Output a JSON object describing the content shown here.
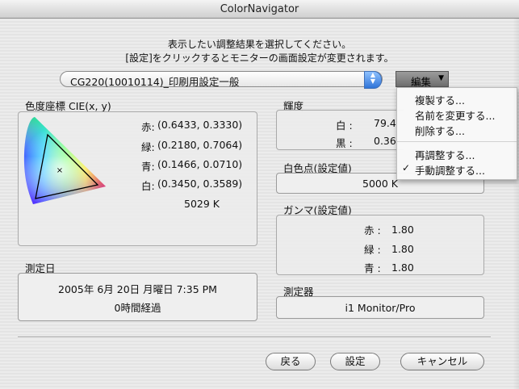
{
  "window": {
    "title": "ColorNavigator"
  },
  "instructions": {
    "line1": "表示したい調整結果を選択してください。",
    "line2": "[設定]をクリックするとモニターの画面設定が変更されます。"
  },
  "profile_select": {
    "value": "CG220(10010114)_印刷用設定一般"
  },
  "edit_menu": {
    "label": "編集",
    "items": [
      "複製する...",
      "名前を変更する...",
      "削除する...",
      "再調整する...",
      "手動調整する..."
    ],
    "checked_item": "手動調整する..."
  },
  "chromaticity": {
    "title": "色度座標 CIE(x, y)",
    "red_label": "赤:",
    "red_value": "(0.6433, 0.3330)",
    "green_label": "緑:",
    "green_value": "(0.2180, 0.7064)",
    "blue_label": "青:",
    "blue_value": "(0.1466, 0.0710)",
    "white_label": "白:",
    "white_value": "(0.3450, 0.3589)",
    "temperature": "5029 K"
  },
  "luminance": {
    "title": "輝度",
    "white_label": "白 :",
    "white_value": "79.4",
    "black_label": "黒 :",
    "black_value": "0.36"
  },
  "whitepoint": {
    "title": "白色点(設定値)",
    "value": "5000 K"
  },
  "gamma": {
    "title": "ガンマ(設定値)",
    "red_label": "赤 :",
    "red_value": "1.80",
    "green_label": "緑 :",
    "green_value": "1.80",
    "blue_label": "青 :",
    "blue_value": "1.80"
  },
  "measured_date": {
    "title": "測定日",
    "date": "2005年 6月 20日 月曜日 7:35 PM",
    "elapsed": "0時間経過"
  },
  "instrument": {
    "title": "測定器",
    "value": "i1 Monitor/Pro"
  },
  "buttons": {
    "back": "戻る",
    "apply": "設定",
    "cancel": "キャンセル"
  },
  "colors": {
    "accent": "#2f74d8"
  }
}
